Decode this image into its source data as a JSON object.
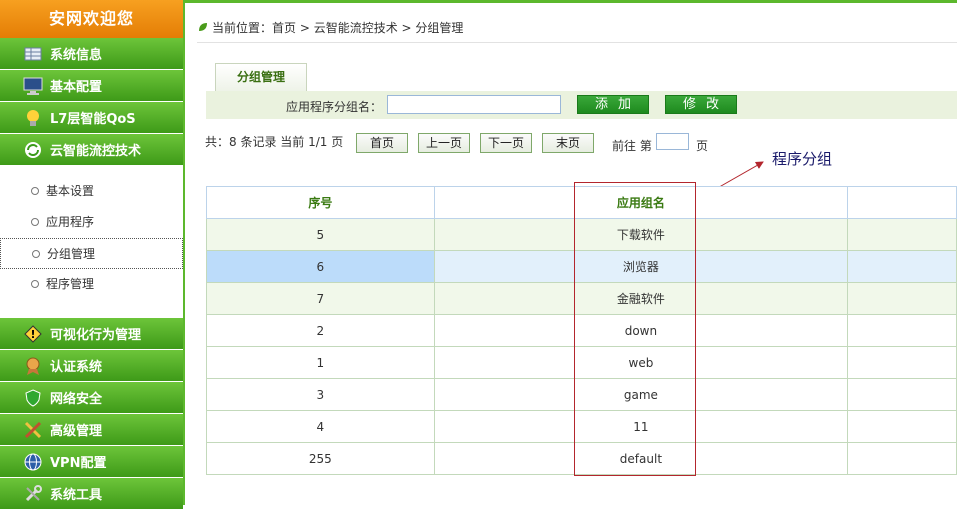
{
  "sidebar": {
    "title": "安网欢迎您",
    "items_top": [
      {
        "label": "系统信息",
        "icon": "table-icon"
      },
      {
        "label": "基本配置",
        "icon": "monitor-icon"
      },
      {
        "label": "L7层智能QoS",
        "icon": "lightbulb-icon"
      },
      {
        "label": "云智能流控技术",
        "icon": "refresh-icon"
      }
    ],
    "sub_items": [
      {
        "label": "基本设置"
      },
      {
        "label": "应用程序"
      },
      {
        "label": "分组管理"
      },
      {
        "label": "程序管理"
      }
    ],
    "items_bottom": [
      {
        "label": "可视化行为管理",
        "icon": "warning-icon"
      },
      {
        "label": "认证系统",
        "icon": "medal-icon"
      },
      {
        "label": "网络安全",
        "icon": "shield-icon"
      },
      {
        "label": "高级管理",
        "icon": "tools-icon"
      },
      {
        "label": "VPN配置",
        "icon": "globe-icon"
      },
      {
        "label": "系统工具",
        "icon": "wrench-icon"
      }
    ]
  },
  "breadcrumb": {
    "prefix": "当前位置：",
    "parts": [
      "首页",
      "云智能流控技术",
      "分组管理"
    ],
    "sep": " > "
  },
  "tab": {
    "label": "分组管理"
  },
  "toolbar": {
    "label": "应用程序分组名：",
    "input_value": "",
    "add_label": "添加",
    "edit_label": "修改"
  },
  "pager": {
    "summary": "共：8 条记录 当前 1/1 页",
    "first": "首页",
    "prev": "上一页",
    "next": "下一页",
    "last": "末页",
    "goto_prefix": "前往 第",
    "goto_value": "",
    "goto_suffix": "页"
  },
  "annotation": {
    "text": "程序分组"
  },
  "table": {
    "headers": [
      "序号",
      "应用组名",
      "",
      ""
    ],
    "rows": [
      {
        "id": "5",
        "name": "下载软件"
      },
      {
        "id": "6",
        "name": "浏览器"
      },
      {
        "id": "7",
        "name": "金融软件"
      },
      {
        "id": "2",
        "name": "down"
      },
      {
        "id": "1",
        "name": "web"
      },
      {
        "id": "3",
        "name": "game"
      },
      {
        "id": "4",
        "name": "11"
      },
      {
        "id": "255",
        "name": "default"
      }
    ]
  },
  "colors": {
    "nav_green": "#4aa81f",
    "header_orange": "#ef8d12",
    "annotation_red": "#b3262d"
  }
}
